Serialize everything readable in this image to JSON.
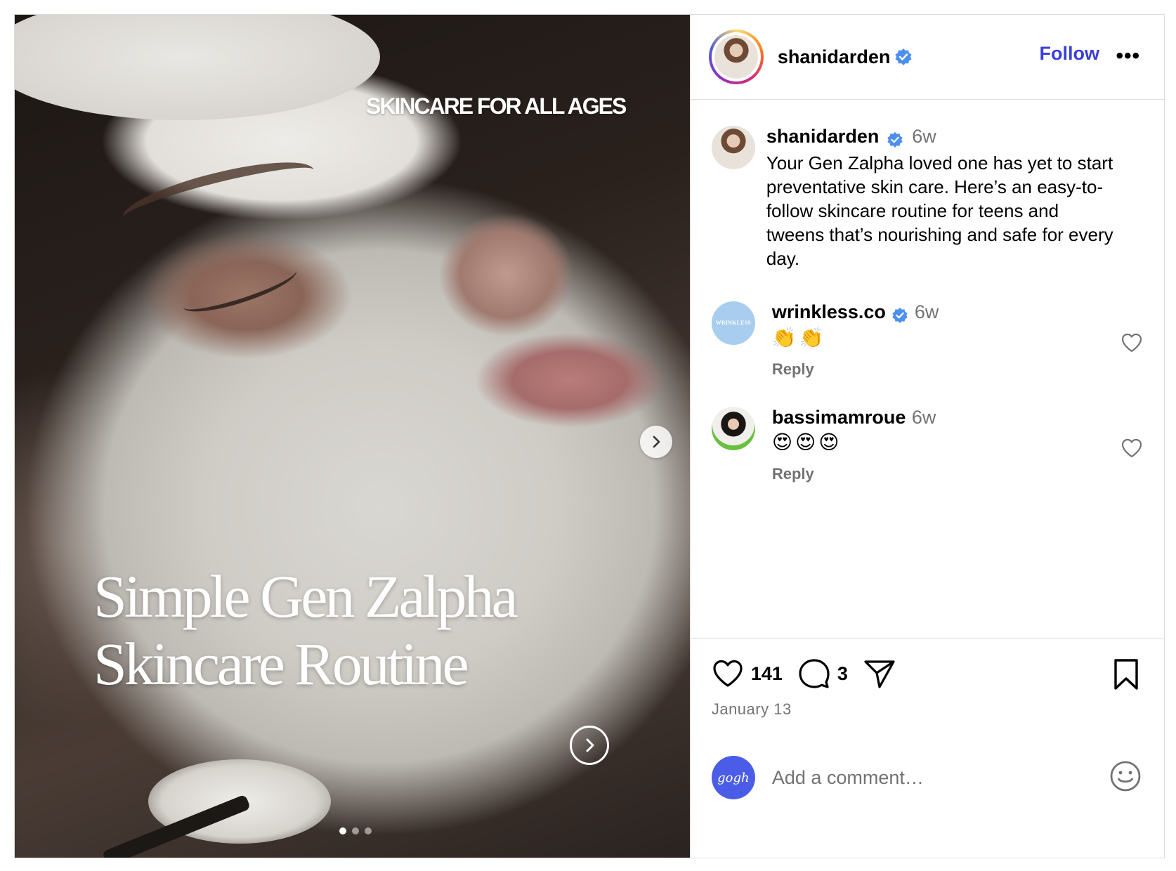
{
  "media": {
    "overlay_top": "SKINCARE FOR ALL AGES",
    "overlay_title_line1": "Simple Gen Zalpha",
    "overlay_title_line2": "Skincare Routine",
    "carousel_count": 3,
    "carousel_active_index": 0
  },
  "header": {
    "username": "shanidarden",
    "follow_label": "Follow",
    "more_label": "•••"
  },
  "caption": {
    "username": "shanidarden",
    "time": "6w",
    "text": "Your Gen Zalpha loved one has yet to start preventative skin care. Here’s an easy-to-follow skincare routine for teens and tweens that’s nourishing and safe for every day."
  },
  "comments": [
    {
      "username": "wrinkless.co",
      "verified": true,
      "time": "6w",
      "text": "👏👏",
      "reply_label": "Reply",
      "avatar_text": "WRINKLESS"
    },
    {
      "username": "bassimamroue",
      "verified": false,
      "time": "6w",
      "text": "😍😍😍",
      "reply_label": "Reply"
    }
  ],
  "actions": {
    "likes": "141",
    "comments_count": "3",
    "date": "January 13"
  },
  "add_comment": {
    "placeholder": "Add a comment…",
    "avatar_text": "gogh"
  },
  "colors": {
    "accent": "#3a3fd8",
    "verified": "#4c8ff1",
    "muted": "#737373",
    "border": "#dbdbdb"
  }
}
